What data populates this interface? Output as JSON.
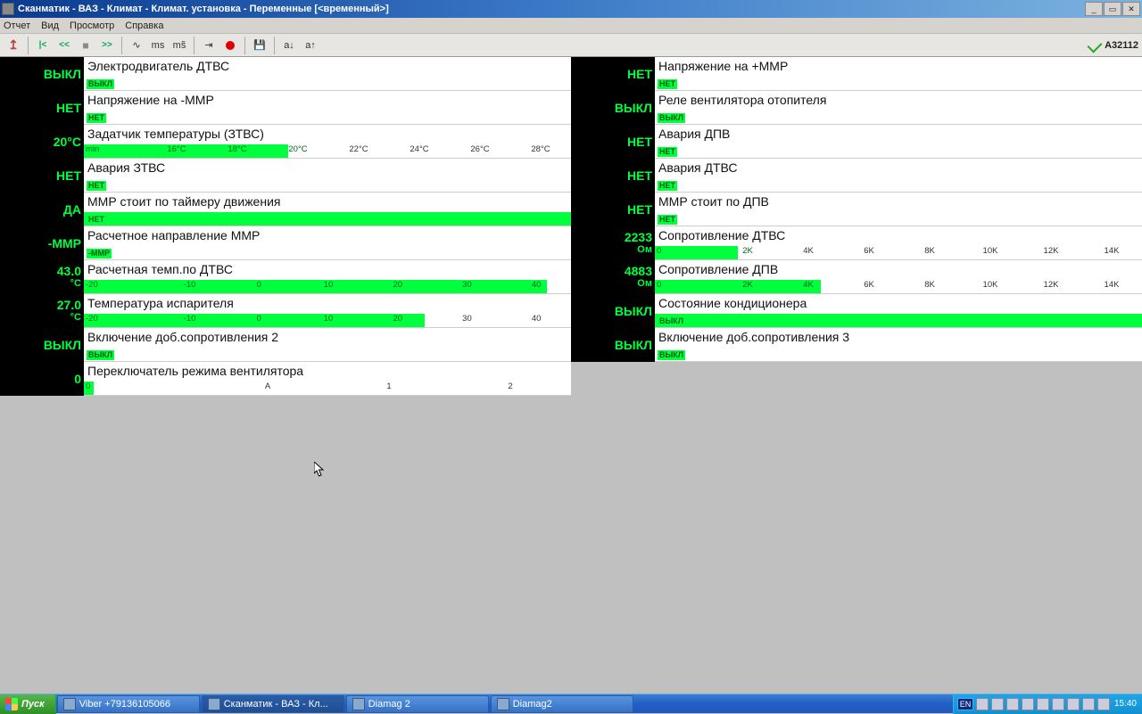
{
  "window": {
    "title": "Сканматик - ВАЗ - Климат - Климат. установка - Переменные [<временный>]"
  },
  "menu": {
    "report": "Отчет",
    "view": "Вид",
    "browse": "Просмотр",
    "help": "Справка"
  },
  "toolbar": {
    "status_code": "A32112"
  },
  "rows_left": [
    {
      "value": "ВЫКЛ",
      "unit": "",
      "label": "Электродвигатель ДТВС",
      "badge": "ВЫКЛ",
      "bar": null
    },
    {
      "value": "НЕТ",
      "unit": "",
      "label": "Напряжение на -ММР",
      "badge": "НЕТ",
      "bar": null
    },
    {
      "value": "20°C",
      "unit": "",
      "label": "Задатчик температуры (ЗТВС)",
      "badge": "",
      "bar": {
        "fill_pct": 42,
        "ticks": [
          "min",
          "16°C",
          "18°C",
          "20°C",
          "22°C",
          "24°C",
          "26°C",
          "28°C"
        ],
        "on_count": 4
      }
    },
    {
      "value": "НЕТ",
      "unit": "",
      "label": "Авария ЗТВС",
      "badge": "НЕТ",
      "bar": null
    },
    {
      "value": "ДА",
      "unit": "",
      "label": "ММР стоит по таймеру движения",
      "badge": "НЕТ",
      "bar": {
        "fill_pct": 100,
        "ticks": [],
        "on_count": 0
      }
    },
    {
      "value": "-ММР",
      "unit": "",
      "label": "Расчетное направление ММР",
      "badge": "-ММР",
      "bar": null
    },
    {
      "value": "43.0",
      "unit": "°C",
      "label": "Расчетная темп.по ДТВС",
      "badge": "",
      "bar": {
        "fill_pct": 95,
        "ticks": [
          "-20",
          "-10",
          "0",
          "10",
          "20",
          "30",
          "40"
        ],
        "on_count": 7
      }
    },
    {
      "value": "27.0",
      "unit": "°C",
      "label": "Температура испарителя",
      "badge": "",
      "bar": {
        "fill_pct": 70,
        "ticks": [
          "-20",
          "-10",
          "0",
          "10",
          "20",
          "30",
          "40"
        ],
        "on_count": 5
      }
    },
    {
      "value": "ВЫКЛ",
      "unit": "",
      "label": "Включение доб.сопротивления 2",
      "badge": "ВЫКЛ",
      "bar": null
    },
    {
      "value": "0",
      "unit": "",
      "label": "Переключатель режима вентилятора",
      "badge": "",
      "bar": {
        "fill_pct": 2,
        "ticks": [
          "0",
          "А",
          "1",
          "2"
        ],
        "on_count": 1
      }
    }
  ],
  "rows_right": [
    {
      "value": "НЕТ",
      "unit": "",
      "label": "Напряжение на +ММР",
      "badge": "НЕТ",
      "bar": null
    },
    {
      "value": "ВЫКЛ",
      "unit": "",
      "label": "Реле вентилятора отопителя",
      "badge": "ВЫКЛ",
      "bar": null
    },
    {
      "value": "НЕТ",
      "unit": "",
      "label": "Авария ДПВ",
      "badge": "НЕТ",
      "bar": null
    },
    {
      "value": "НЕТ",
      "unit": "",
      "label": "Авария ДТВС",
      "badge": "НЕТ",
      "bar": null
    },
    {
      "value": "НЕТ",
      "unit": "",
      "label": "ММР стоит по ДПВ",
      "badge": "НЕТ",
      "bar": null
    },
    {
      "value": "2233",
      "unit": "Ом",
      "label": "Сопротивление ДТВС",
      "badge": "",
      "bar": {
        "fill_pct": 17,
        "ticks": [
          "0",
          "2K",
          "4K",
          "6K",
          "8K",
          "10K",
          "12K",
          "14K"
        ],
        "on_count": 2
      }
    },
    {
      "value": "4883",
      "unit": "Ом",
      "label": "Сопротивление ДПВ",
      "badge": "",
      "bar": {
        "fill_pct": 34,
        "ticks": [
          "0",
          "2K",
          "4K",
          "6K",
          "8K",
          "10K",
          "12K",
          "14K"
        ],
        "on_count": 3
      }
    },
    {
      "value": "ВЫКЛ",
      "unit": "",
      "label": "Состояние кондиционера",
      "badge": "ВЫКЛ",
      "bar": {
        "fill_pct": 100,
        "ticks": [],
        "on_count": 0
      }
    },
    {
      "value": "ВЫКЛ",
      "unit": "",
      "label": "Включение доб.сопротивления 3",
      "badge": "ВЫКЛ",
      "bar": null
    }
  ],
  "taskbar": {
    "start": "Пуск",
    "items": [
      {
        "label": "Viber +79136105066",
        "active": false
      },
      {
        "label": "Сканматик - ВАЗ - Кл...",
        "active": true
      },
      {
        "label": "Diamag 2",
        "active": false
      },
      {
        "label": "Diamag2",
        "active": false
      }
    ],
    "lang": "EN",
    "clock": "15:40"
  }
}
